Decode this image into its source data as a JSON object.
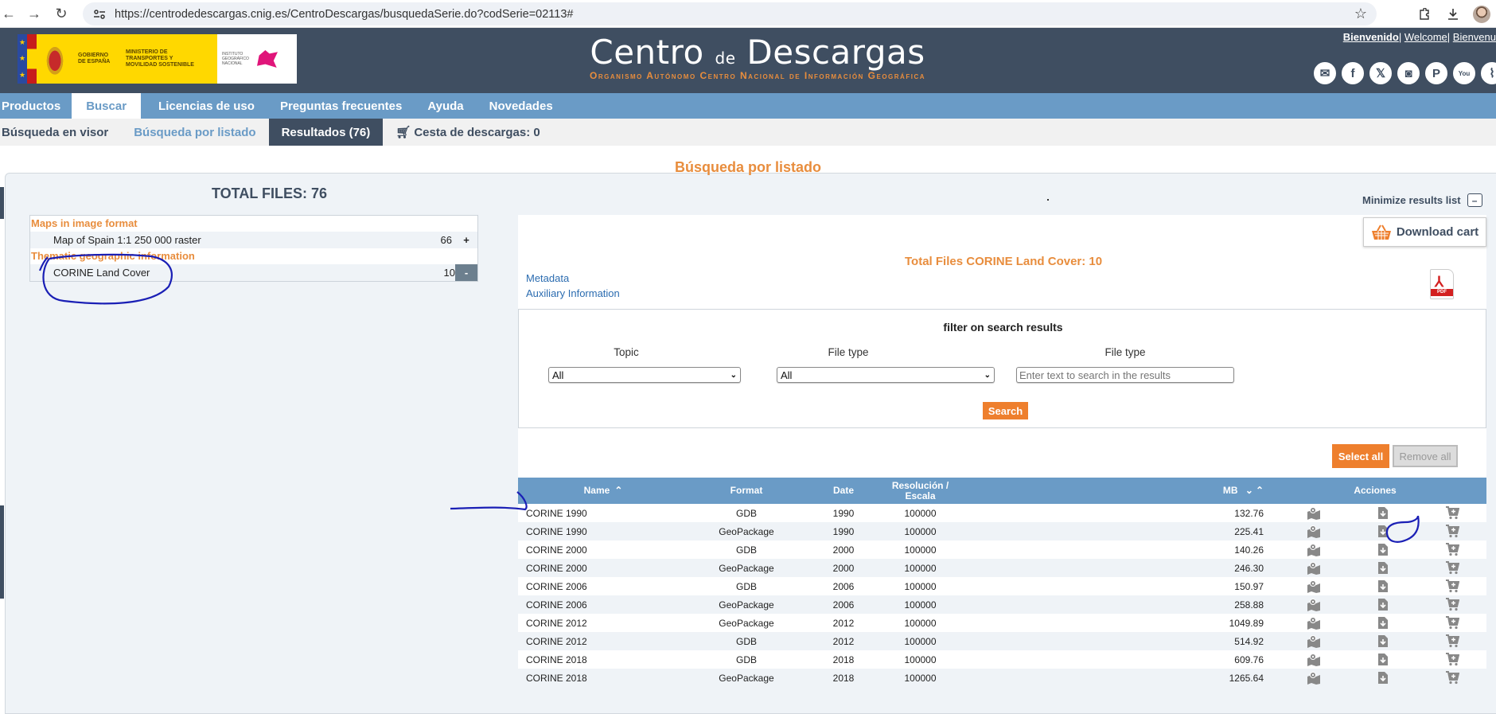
{
  "browser": {
    "url": "https://centrodedescargas.cnig.es/CentroDescargas/busquedaSerie.do?codSerie=02113#"
  },
  "header": {
    "logo": {
      "gobierno": "GOBIERNO DE ESPAÑA",
      "ministerio": "MINISTERIO DE TRANSPORTES Y MOVILIDAD SOSTENIBLE",
      "instituto": "INSTITUTO GEOGRÁFICO NACIONAL"
    },
    "title_part1": "Centro",
    "title_de": "de",
    "title_part2": "Descargas",
    "subtitle": "Organismo Autónomo Centro Nacional de Información Geográfica",
    "lang_links": [
      "Bienvenido",
      "Welcome",
      "Bienvenu"
    ],
    "social": [
      "mail-icon",
      "facebook-icon",
      "x-icon",
      "instagram-icon",
      "pinterest-icon",
      "youtube-icon",
      "rss-icon"
    ]
  },
  "menu": {
    "items": [
      "Productos",
      "Buscar",
      "Licencias de uso",
      "Preguntas frecuentes",
      "Ayuda",
      "Novedades"
    ],
    "active": "Buscar"
  },
  "subnav": {
    "items": [
      "Búsqueda en visor",
      "Búsqueda por listado",
      "Resultados (76)"
    ],
    "cart": "Cesta de descargas: 0"
  },
  "main": {
    "page_title": "Búsqueda por listado",
    "total_files": "TOTAL FILES: 76",
    "minimize": "Minimize results list",
    "tree": [
      {
        "group": "Maps in image format",
        "item": "Map of Spain 1:1 250 000 raster",
        "count": "66",
        "toggle": "+"
      },
      {
        "group": "Thematic geographic information",
        "item": "CORINE Land Cover",
        "count": "10",
        "toggle": "-"
      }
    ]
  },
  "results": {
    "download_cart": "Download cart",
    "files_count": "Total Files  CORINE Land Cover: 10",
    "metadata": "Metadata",
    "auxiliary": "Auxiliary Information",
    "pdf_label": "PDF",
    "filter": {
      "title": "filter on search results",
      "topic_label": "Topic",
      "topic_value": "All",
      "filetype_label": "File type",
      "filetype_value": "All",
      "text_label": "File type",
      "text_placeholder": "Enter text to search in the results",
      "search_button": "Search"
    },
    "select_all": "Select all",
    "remove_all": "Remove all",
    "columns": {
      "name": "Name",
      "format": "Format",
      "date": "Date",
      "res1": "Resolución /",
      "res2": "Escala",
      "mb": "MB",
      "actions": "Acciones"
    },
    "rows": [
      {
        "name": "CORINE 1990",
        "format": "GDB",
        "date": "1990",
        "scale": "100000",
        "mb": "132.76"
      },
      {
        "name": "CORINE 1990",
        "format": "GeoPackage",
        "date": "1990",
        "scale": "100000",
        "mb": "225.41"
      },
      {
        "name": "CORINE 2000",
        "format": "GDB",
        "date": "2000",
        "scale": "100000",
        "mb": "140.26"
      },
      {
        "name": "CORINE 2000",
        "format": "GeoPackage",
        "date": "2000",
        "scale": "100000",
        "mb": "246.30"
      },
      {
        "name": "CORINE 2006",
        "format": "GDB",
        "date": "2006",
        "scale": "100000",
        "mb": "150.97"
      },
      {
        "name": "CORINE 2006",
        "format": "GeoPackage",
        "date": "2006",
        "scale": "100000",
        "mb": "258.88"
      },
      {
        "name": "CORINE 2012",
        "format": "GeoPackage",
        "date": "2012",
        "scale": "100000",
        "mb": "1049.89"
      },
      {
        "name": "CORINE 2012",
        "format": "GDB",
        "date": "2012",
        "scale": "100000",
        "mb": "514.92"
      },
      {
        "name": "CORINE 2018",
        "format": "GDB",
        "date": "2018",
        "scale": "100000",
        "mb": "609.76"
      },
      {
        "name": "CORINE 2018",
        "format": "GeoPackage",
        "date": "2018",
        "scale": "100000",
        "mb": "1265.64"
      }
    ]
  },
  "colors": {
    "header_bg": "#3f4e61",
    "menu_bg": "#6a9bc6",
    "accent_orange": "#ee7f2d",
    "annotation_ink": "#1a1fb5"
  }
}
